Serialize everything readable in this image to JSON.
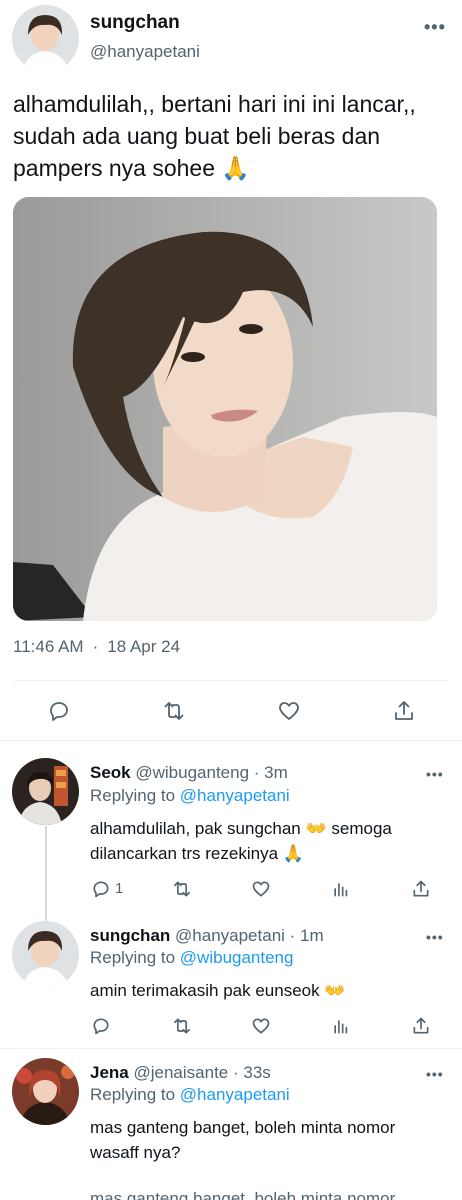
{
  "main_tweet": {
    "display_name": "sungchan",
    "handle": "@hanyapetani",
    "text": "alhamdulilah,, bertani hari ini ini lancar,, sudah ada uang buat beli beras dan pampers nya sohee 🙏",
    "time": "11:46 AM",
    "date": "18 Apr 24",
    "more_label": "•••"
  },
  "replies": [
    {
      "display_name": "Seok",
      "handle": "@wibuganteng",
      "age": "· 3m",
      "replying_prefix": "Replying to",
      "replying_to": "@hanyapetani",
      "text": "alhamdulilah, pak sungchan 👐 semoga dilancarkan trs rezekinya 🙏",
      "reply_count": "1",
      "more_label": "•••"
    },
    {
      "display_name": "sungchan",
      "handle": "@hanyapetani",
      "age": "· 1m",
      "replying_prefix": "Replying to",
      "replying_to": "@wibuganteng",
      "text": "amin terimakasih pak eunseok 👐",
      "more_label": "•••"
    },
    {
      "display_name": "Jena",
      "handle": "@jenaisante",
      "age": "· 33s",
      "replying_prefix": "Replying to",
      "replying_to": "@hanyapetani",
      "text": "mas ganteng banget, boleh minta nomor wasaff nya?",
      "more_label": "•••"
    }
  ],
  "cut_off_text": "mas ganteng banget, boleh minta nomor",
  "icons": {
    "reply": "reply-icon",
    "retweet": "retweet-icon",
    "like": "heart-icon",
    "views": "views-icon",
    "share": "share-icon"
  }
}
